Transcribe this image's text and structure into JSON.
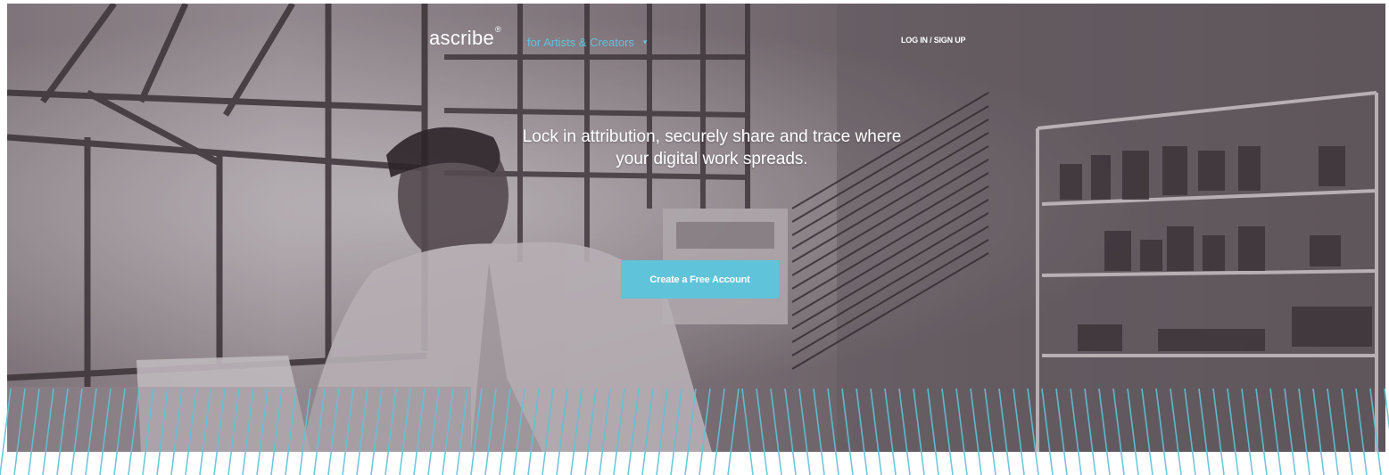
{
  "brand": {
    "name": "ascribe",
    "mark": "®",
    "tagline": "for Artists & Creators",
    "tagline_icon": "chevron-down-icon"
  },
  "nav": {
    "login_label": "LOG IN / SIGN UP"
  },
  "hero": {
    "headline_line1": "Lock in attribution, securely share and trace where",
    "headline_line2": "your digital work spreads.",
    "cta_label": "Create a Free Account"
  },
  "colors": {
    "accent": "#5fc3d9",
    "text_light": "#ffffff",
    "photo_tone": "#8a8286"
  }
}
